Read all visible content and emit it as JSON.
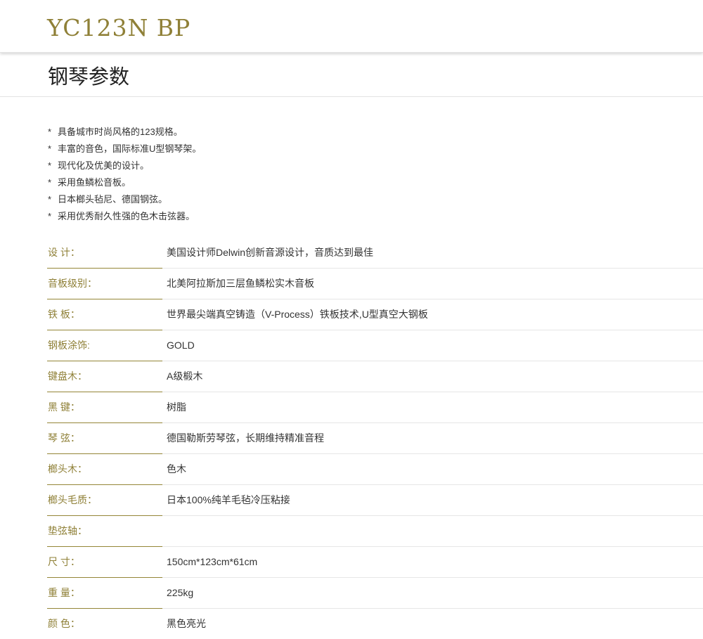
{
  "header": {
    "model": "YC123N BP"
  },
  "section": {
    "title": "钢琴参数"
  },
  "features": [
    "具备城市时尚风格的123规格。",
    "丰富的音色，国际标准U型钢琴架。",
    "现代化及优美的设计。",
    "采用鱼鳞松音板。",
    "日本榔头毡尼、德国钢弦。",
    "采用优秀耐久性强的色木击弦器。"
  ],
  "feature_marker": "*",
  "specs": [
    {
      "label": "设  计：",
      "value": "美国设计师Delwin创新音源设计，音质达到最佳"
    },
    {
      "label": "音板级别：",
      "value": "北美阿拉斯加三层鱼鳞松实木音板"
    },
    {
      "label": "铁  板：",
      "value": "世界最尖端真空铸造（V-Process）铁板技术,U型真空大钢板"
    },
    {
      "label": "钢板涂饰:",
      "value": "GOLD"
    },
    {
      "label": "键盘木：",
      "value": "A级椴木"
    },
    {
      "label": "黑  键：",
      "value": "树脂"
    },
    {
      "label": "琴  弦：",
      "value": "德国勒斯劳琴弦，长期维持精准音程"
    },
    {
      "label": "榔头木：",
      "value": "色木"
    },
    {
      "label": "榔头毛质：",
      "value": "日本100%纯羊毛毡冷压粘接"
    },
    {
      "label": "垫弦轴：",
      "value": ""
    },
    {
      "label": "尺  寸：",
      "value": "150cm*123cm*61cm"
    },
    {
      "label": "重  量：",
      "value": "225kg"
    },
    {
      "label": "颜  色：",
      "value": "黑色亮光"
    }
  ],
  "colors": {
    "accent_gold": "#8f8037",
    "text": "#333333",
    "divider": "#e6e6e6"
  }
}
